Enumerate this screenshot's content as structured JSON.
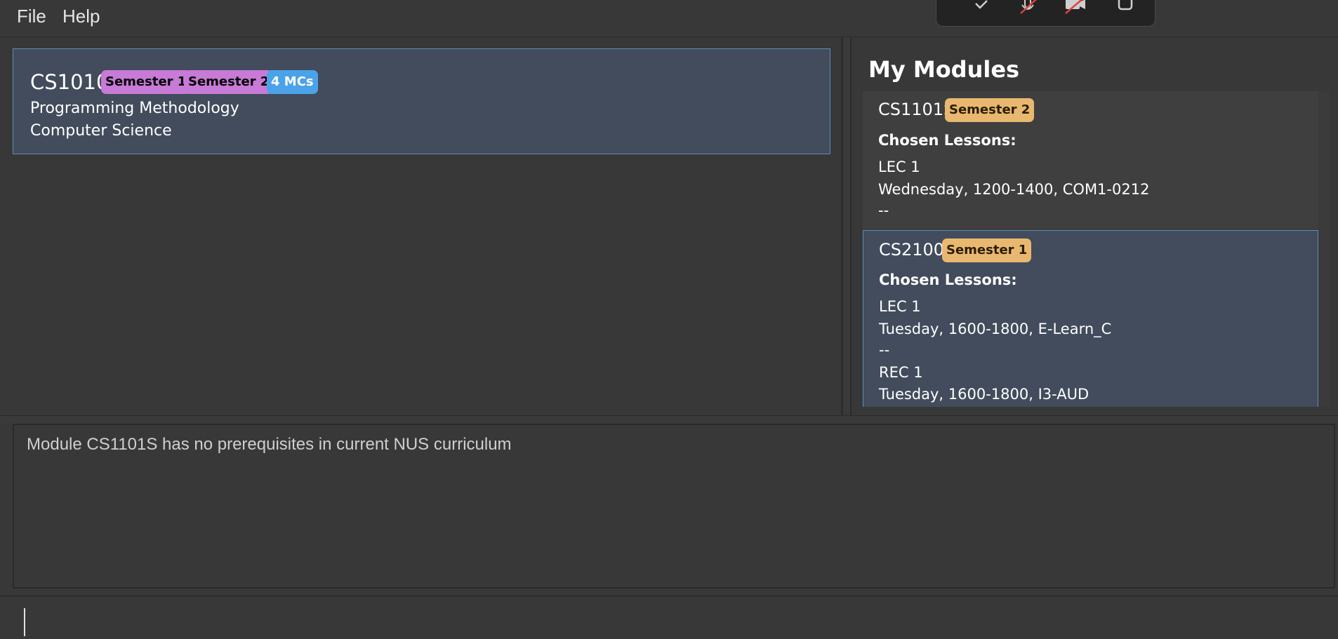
{
  "menu": {
    "file": "File",
    "help": "Help"
  },
  "call_toolbar": {
    "icons": [
      "check-icon",
      "mic-muted-icon",
      "camera-off-icon",
      "share-icon"
    ]
  },
  "search_result": {
    "code": "CS1010",
    "tags": [
      "Semester 1",
      "Semester 2",
      "4 MCs"
    ],
    "title": "Programming Methodology",
    "department": "Computer Science"
  },
  "my_modules": {
    "title": "My Modules",
    "items": [
      {
        "code": "CS1101S",
        "tag": "Semester 2",
        "heading": "Chosen Lessons:",
        "lines": [
          "LEC 1",
          "Wednesday, 1200-1400, COM1-0212",
          "--"
        ]
      },
      {
        "code": "CS2100",
        "tag": "Semester 1",
        "heading": "Chosen Lessons:",
        "lines": [
          "LEC 1",
          "Tuesday, 1600-1800, E-Learn_C",
          "--",
          "REC 1",
          "Tuesday, 1600-1800, I3-AUD"
        ]
      }
    ]
  },
  "result_display": {
    "text": "Module CS1101S has no prerequisites in current NUS curriculum"
  },
  "command_box": {
    "value": "",
    "placeholder": ""
  },
  "colors": {
    "background": "#383838",
    "card_selected": "#424c5c",
    "tag_semester": "#c77ad6",
    "tag_mcs": "#4aa3e8",
    "tag_chosen_semester": "#e9b870"
  }
}
